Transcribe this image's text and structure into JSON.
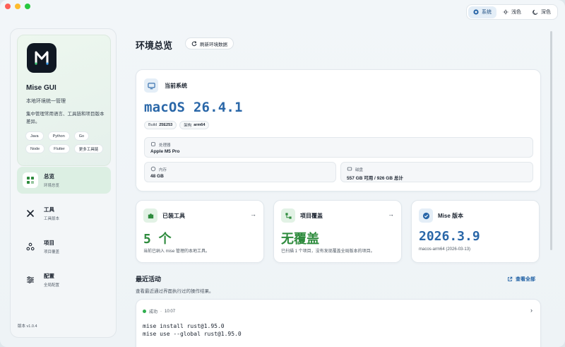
{
  "theme": {
    "options": [
      {
        "label": "系统",
        "icon": "system-icon"
      },
      {
        "label": "浅色",
        "icon": "sun-icon"
      },
      {
        "label": "深色",
        "icon": "moon-icon"
      }
    ],
    "active": "系统"
  },
  "brand": {
    "title": "Mise GUI",
    "subtitle": "本地环境统一管理",
    "description": "集中管理常用语言、工具链和项目版本差异。",
    "chips": [
      "Java",
      "Python",
      "Go",
      "Node",
      "Flutter",
      "更多工具链"
    ]
  },
  "nav": [
    {
      "title": "总览",
      "sub": "环境总览",
      "icon": "dashboard-icon"
    },
    {
      "title": "工具",
      "sub": "工具版本",
      "icon": "tools-icon"
    },
    {
      "title": "项目",
      "sub": "项目覆盖",
      "icon": "project-icon"
    },
    {
      "title": "配置",
      "sub": "全局配置",
      "icon": "settings-icon"
    }
  ],
  "version_label": "版本 v1.0.4",
  "page": {
    "title": "环境总览",
    "refresh_label": "刷新环境数据"
  },
  "system": {
    "label": "当前系统",
    "os": "macOS 26.4.1",
    "build_label": "Build",
    "build": "25E253",
    "arch_label": "架构",
    "arch": "arm64",
    "cpu_label": "处理器",
    "cpu": "Apple M5 Pro",
    "mem_label": "内存",
    "mem": "48 GB",
    "disk_label": "磁盘",
    "disk": "557 GB 可用 / 926 GB 总计"
  },
  "stats": [
    {
      "label": "已装工具",
      "value": "5 个",
      "desc": "当前已纳入 mise 管理的本地工具。",
      "color": "#2e8b3d"
    },
    {
      "label": "项目覆盖",
      "value": "无覆盖",
      "desc": "已扫描 1 个项目，没有发现覆盖全局版本的项目。",
      "color": "#2e8b3d"
    },
    {
      "label": "Mise 版本",
      "value": "2026.3.9",
      "desc": "macos-arm64 (2026-03-13)",
      "color": "#2a67a8"
    }
  ],
  "activity": {
    "title": "最近活动",
    "subtitle": "查看最近通过界面执行过的操作结果。",
    "view_all": "查看全部",
    "status": "成功",
    "time": "10:07",
    "commands": [
      "mise install rust@1.95.0",
      "mise use --global rust@1.95.0"
    ]
  }
}
